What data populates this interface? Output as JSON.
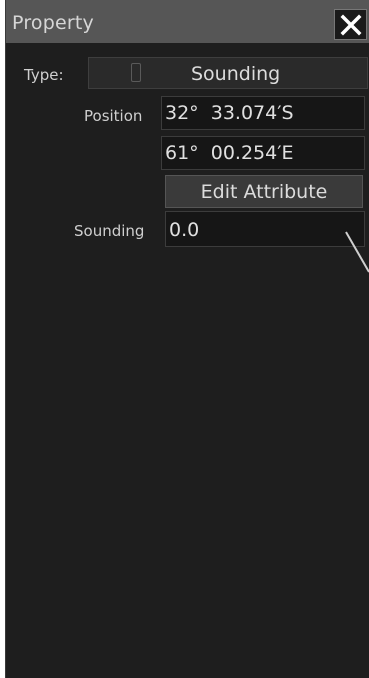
{
  "window": {
    "title": "Property",
    "close_icon": "close-icon"
  },
  "type_row": {
    "label": "Type:",
    "value": "Sounding"
  },
  "position": {
    "label": "Position",
    "latitude": "32°  33.074′S",
    "longitude": "61°  00.254′E"
  },
  "edit_attribute": {
    "label": "Edit Attribute"
  },
  "sounding": {
    "label": "Sounding",
    "value": "0.0"
  },
  "colors": {
    "panel_bg": "#1e1e1e",
    "titlebar_bg": "#565656",
    "field_bg": "#161616",
    "text": "#dcdcdc"
  }
}
